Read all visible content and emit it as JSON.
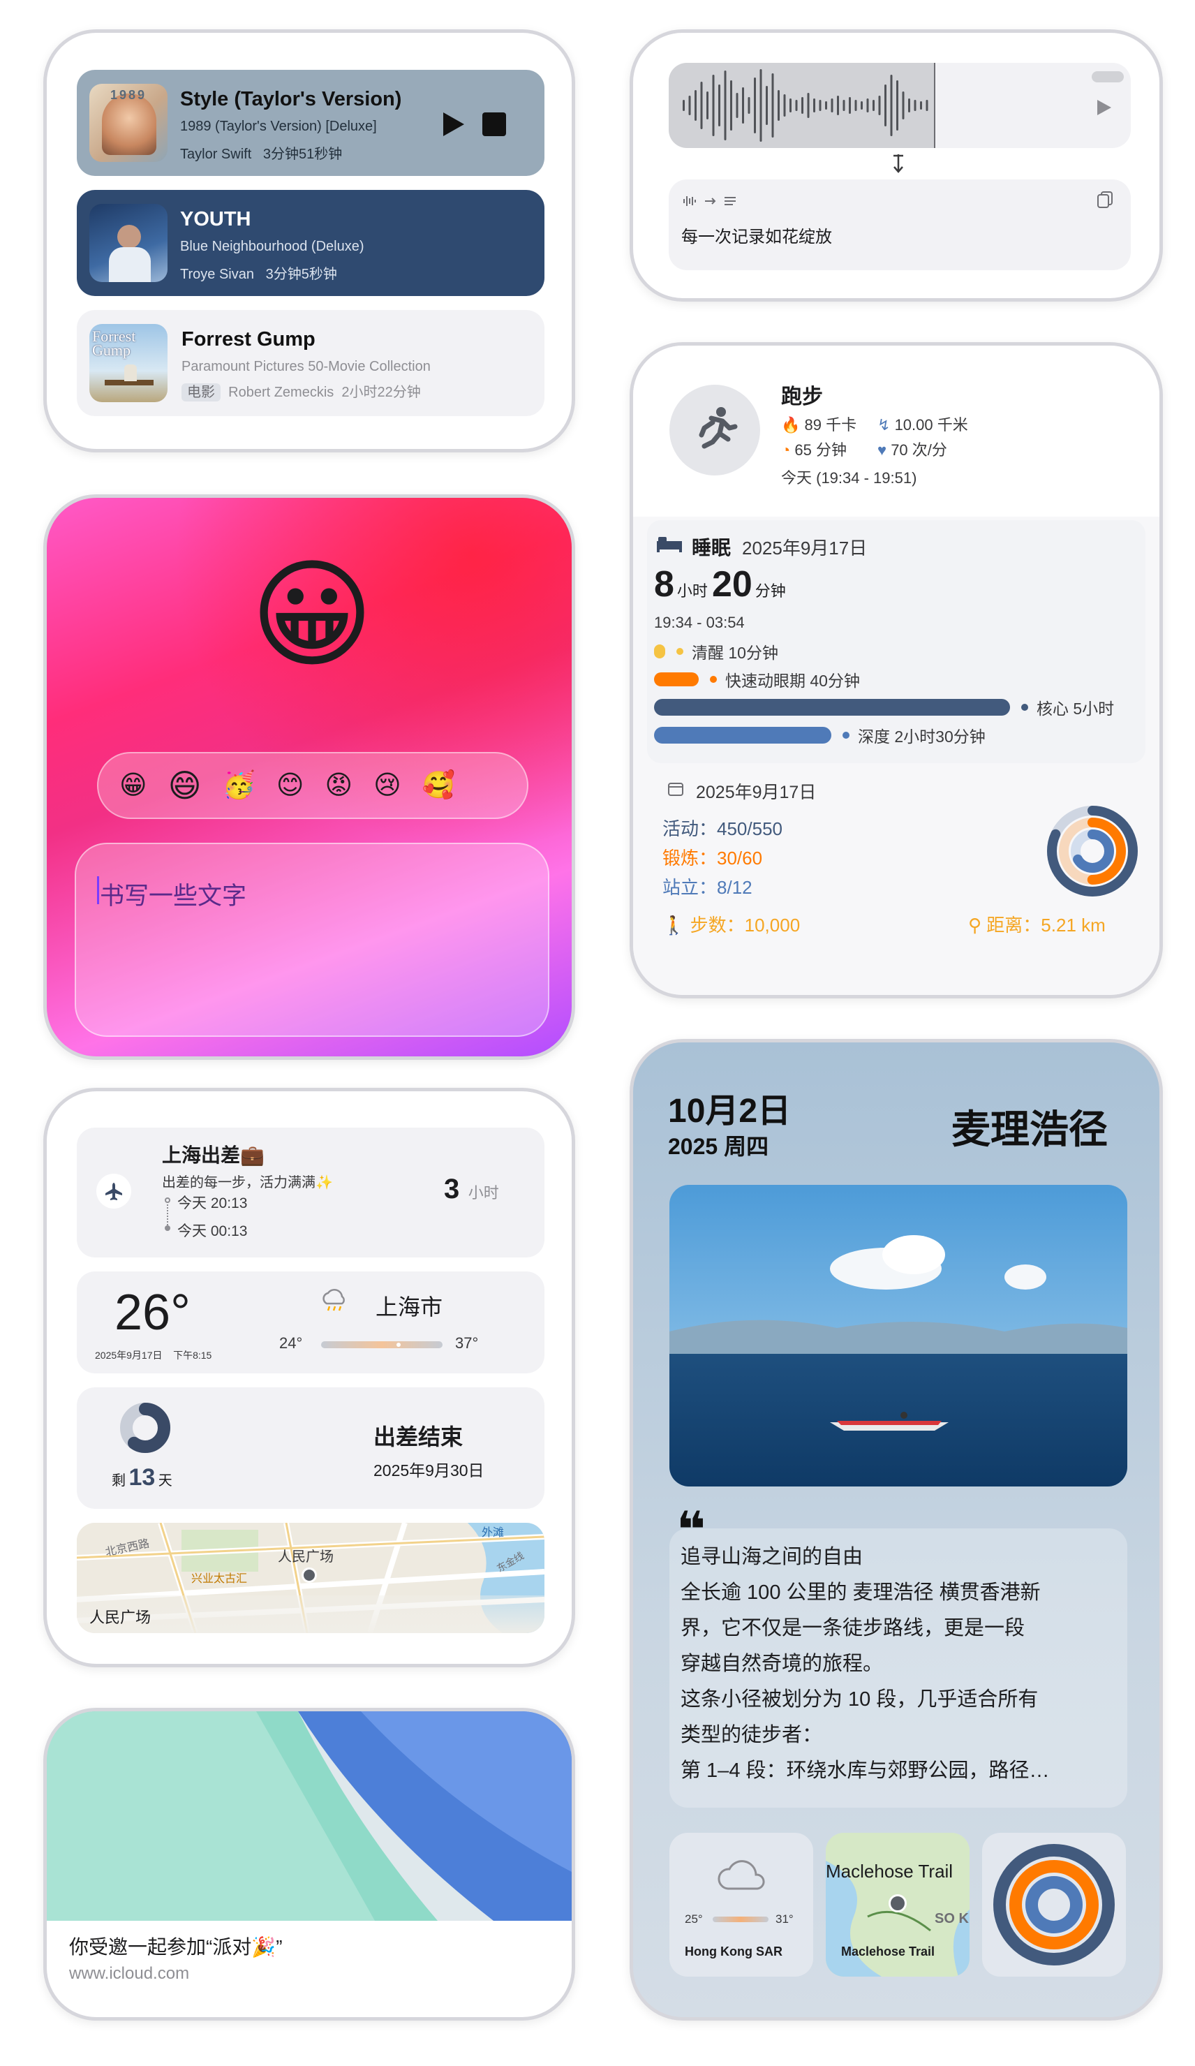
{
  "music": {
    "items": [
      {
        "title": "Style (Taylor's Version)",
        "album": "1989 (Taylor's Version) [Deluxe]",
        "artist": "Taylor Swift",
        "duration": "3分钟51秒钟"
      },
      {
        "title": "YOUTH",
        "album": "Blue Neighbourhood (Deluxe)",
        "artist": "Troye Sivan",
        "duration": "3分钟5秒钟"
      },
      {
        "title": "Forrest Gump",
        "album": "Paramount Pictures 50-Movie Collection",
        "tag": "电影",
        "artist": "Robert Zemeckis",
        "duration": "2小时22分钟"
      }
    ],
    "cover_text_1": "1989",
    "cover_text_3": "Forrest Gump"
  },
  "voice": {
    "text": "每一次记录如花绽放"
  },
  "emoji": {
    "main": "😀",
    "strip": [
      "😁",
      "😄",
      "🥳",
      "😊",
      "😡",
      "😢",
      "🥰"
    ],
    "placeholder": "书写一些文字"
  },
  "fitness": {
    "title": "跑步",
    "kcal": "89 千卡",
    "distance": "10.00 千米",
    "duration": "65 分钟",
    "heart": "70 次/分",
    "time": "今天 (19:34 - 19:51)"
  },
  "sleep": {
    "title": "睡眠",
    "date": "2025年9月17日",
    "hours": "8",
    "hours_unit": "小时",
    "minutes": "20",
    "minutes_unit": "分钟",
    "range": "19:34 - 03:54",
    "stages": [
      {
        "label": "清醒 10分钟",
        "color": "#f5c343",
        "fraction": 0.02
      },
      {
        "label": "快速动眼期 40分钟",
        "color": "#ff7a00",
        "fraction": 0.08
      },
      {
        "label": "核心 5小时",
        "color": "#425a7d",
        "fraction": 0.6
      },
      {
        "label": "深度 2小时30分钟",
        "color": "#4f7ab8",
        "fraction": 0.3
      }
    ]
  },
  "activity": {
    "date": "2025年9月17日",
    "move_label": "活动：",
    "move": "450/550",
    "move_frac": 0.818,
    "exercise_label": "锻炼：",
    "exercise": "30/60",
    "exercise_frac": 0.5,
    "stand_label": "站立：",
    "stand": "8/12",
    "stand_frac": 0.667,
    "steps_label": "步数：",
    "steps": "10,000",
    "distance_label": "距离：",
    "distance": "5.21 km",
    "colors": {
      "move": "#425a7d",
      "exercise": "#ff7a00",
      "stand": "#4f7ab8"
    }
  },
  "trip": {
    "title": "上海出差💼",
    "subtitle": "出差的每一步，活力满满✨",
    "depart": "今天 20:13",
    "arrive": "今天 00:13",
    "hours": "3",
    "hours_unit": "小时",
    "temp": "26°",
    "temp_date": "2025年9月17日",
    "temp_time": "下午8:15",
    "city": "上海市",
    "low": "24°",
    "high": "37°",
    "remain_prefix": "剩",
    "remain_days": "13",
    "remain_suffix": "天",
    "remain_frac": 0.6,
    "end_title": "出差结束",
    "end_date": "2025年9月30日",
    "map_label": "人民广场",
    "map_labels": [
      "北京西路",
      "人民广场",
      "兴业太古汇",
      "外滩",
      "东金线",
      "人民广场"
    ]
  },
  "invite": {
    "title": "你受邀一起参加“派对🎉”",
    "url": "www.icloud.com"
  },
  "hike": {
    "date": "10月2日",
    "year": "2025 周四",
    "title": "麦理浩径",
    "quote_mark": "❝",
    "lines": [
      "追寻山海之间的自由",
      "全长逾 100 公里的 麦理浩径 横贯香港新",
      "界，它不仅是一条徒步路线，更是一段",
      "穿越自然奇境的旅程。",
      "这条小径被划分为 10 段，几乎适合所有",
      "类型的徒步者：",
      "第 1–4 段：环绕水库与郊野公园，路径…"
    ],
    "weather_low": "25°",
    "weather_high": "31°",
    "weather_place": "Hong Kong SAR",
    "map_title": "Maclehose Trail",
    "map_caption": "Maclehose Trail",
    "map_text": "SO K"
  }
}
